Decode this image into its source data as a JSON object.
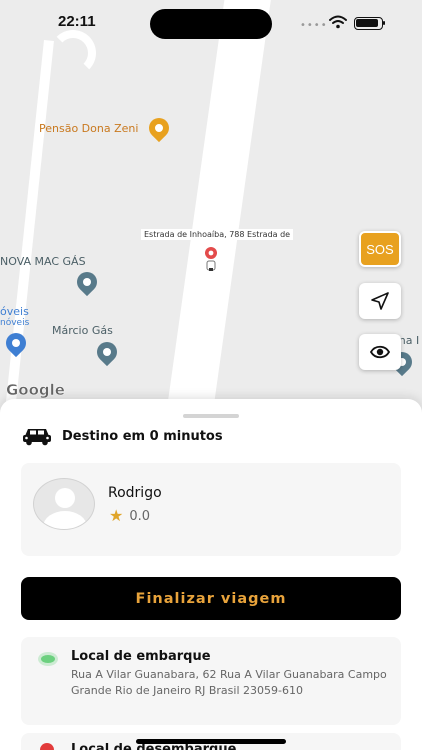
{
  "status_bar": {
    "time": "22:11"
  },
  "map": {
    "pois": {
      "pensao": "Pensão Dona Zeni",
      "nova_mac": "NOVA MAC GÁS",
      "moveis1": "óveis",
      "moveis2": "nóveis",
      "marcio": "Márcio Gás",
      "dona": "ona I"
    },
    "address_label": "Estrada de Inhoaíba, 788 Estrada de",
    "logo": "Google",
    "buttons": {
      "sos": "SOS"
    }
  },
  "sheet": {
    "destination_text": "Destino em 0 minutos",
    "driver": {
      "name": "Rodrigo",
      "rating": "0.0"
    },
    "finish_button": "Finalizar viagem",
    "pickup": {
      "title": "Local de embarque",
      "address": "Rua A Vilar Guanabara, 62 Rua A Vilar Guanabara Campo Grande Rio de Janeiro RJ Brasil 23059-610"
    },
    "dropoff": {
      "title": "Local de desembarque"
    }
  },
  "colors": {
    "accent": "#e8a11f",
    "button_bg": "#000000",
    "button_text": "#e8a33b",
    "pickup_dot": "#6cd07f",
    "dropoff_dot": "#e23b3b"
  }
}
